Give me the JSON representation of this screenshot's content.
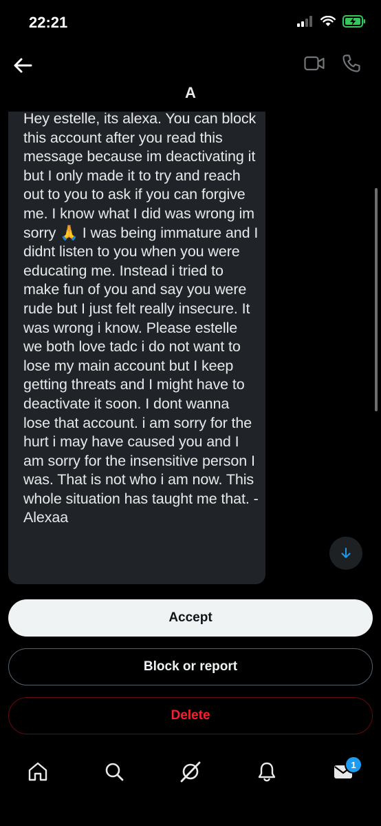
{
  "status_bar": {
    "time": "22:21"
  },
  "header": {
    "title": "A"
  },
  "message": {
    "text": "Hey estelle, its alexa. You can block this account after you read this message because im deactivating it but I only made it to try and reach out to you to ask if you can forgive me. I know what I did was wrong im sorry 🙏 I was being immature and I didnt listen to you when you were educating me. Instead i tried to make fun of you and say you were rude but I just felt really insecure. It was wrong i know. Please estelle we both love tadc i do not want to lose my main account but I keep getting threats and I might have to deactivate it soon. I dont wanna lose that account. i am sorry for the hurt i may have caused you and I am sorry for the insensitive person I was. That is not who i am now. This whole situation has taught me that. -Alexaa"
  },
  "actions": {
    "accept": "Accept",
    "block": "Block or report",
    "delete": "Delete"
  },
  "tabbar": {
    "items": [
      "home-icon",
      "search-icon",
      "grok-icon",
      "notifications-icon",
      "messages-icon"
    ],
    "messages_badge": "1"
  },
  "colors": {
    "accent": "#1d9bf0",
    "danger": "#f4212e",
    "bubble": "#202327",
    "battery": "#34c759"
  }
}
